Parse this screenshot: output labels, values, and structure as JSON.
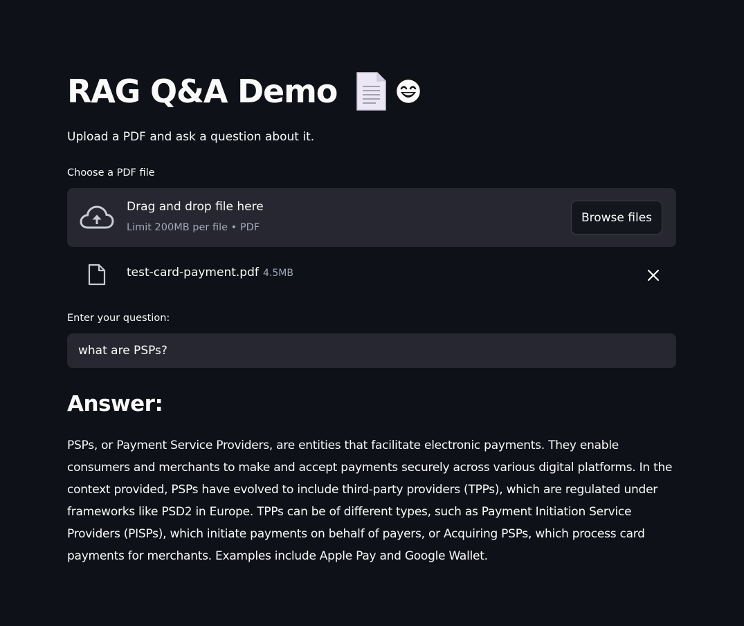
{
  "header": {
    "title": "RAG Q&A Demo",
    "icons": [
      "document-icon",
      "smiling-face-icon"
    ]
  },
  "subtitle": "Upload a PDF and ask a question about it.",
  "uploader": {
    "label": "Choose a PDF file",
    "drop_title": "Drag and drop file here",
    "limit_text": "Limit 200MB per file • PDF",
    "browse_label": "Browse files",
    "file": {
      "name": "test-card-payment.pdf",
      "size": "4.5MB"
    }
  },
  "question": {
    "label": "Enter your question:",
    "value": "what are PSPs?"
  },
  "answer": {
    "heading": "Answer:",
    "text": "PSPs, or Payment Service Providers, are entities that facilitate electronic payments. They enable consumers and merchants to make and accept payments securely across various digital platforms. In the context provided, PSPs have evolved to include third-party providers (TPPs), which are regulated under frameworks like PSD2 in Europe. TPPs can be of different types, such as Payment Initiation Service Providers (PISPs), which initiate payments on behalf of payers, or Acquiring PSPs, which process card payments for merchants. Examples include Apple Pay and Google Wallet."
  },
  "colors": {
    "background": "#0e1117",
    "surface": "#262730",
    "text": "#fafafa",
    "muted": "#a3a8b8"
  }
}
